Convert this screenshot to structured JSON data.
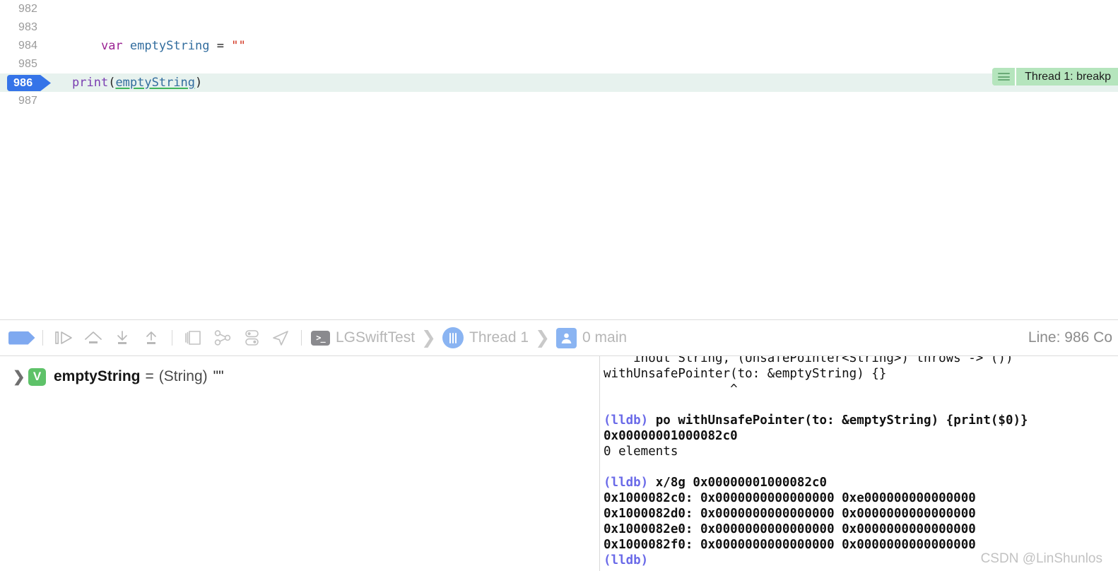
{
  "editor": {
    "lines": [
      {
        "number": "982",
        "segments": [],
        "current": false
      },
      {
        "number": "983",
        "segments": [],
        "current": false
      },
      {
        "number": "984",
        "current": false,
        "segments": [
          {
            "text": "    ",
            "cls": "tok-plain"
          },
          {
            "text": "var",
            "cls": "tok-kw"
          },
          {
            "text": " ",
            "cls": "tok-plain"
          },
          {
            "text": "emptyString",
            "cls": "tok-var"
          },
          {
            "text": " = ",
            "cls": "tok-plain"
          },
          {
            "text": "\"\"",
            "cls": "tok-str"
          }
        ]
      },
      {
        "number": "985",
        "segments": [],
        "current": false
      },
      {
        "number": "986",
        "current": true,
        "segments": [
          {
            "text": "print",
            "cls": "tok-fn"
          },
          {
            "text": "(",
            "cls": "tok-plain"
          },
          {
            "text": "emptyString",
            "cls": "tok-ident-u"
          },
          {
            "text": ")",
            "cls": "tok-plain"
          }
        ]
      },
      {
        "number": "987",
        "segments": [],
        "current": false
      }
    ],
    "breakpoint_line": "986",
    "annotation": {
      "text": "Thread 1: breakp",
      "background": "#b5e5bd"
    }
  },
  "debug_bar": {
    "buttons": [
      {
        "name": "breakpoints-toggle",
        "label": "Breakpoints"
      },
      {
        "name": "continue-button",
        "label": "Continue program execution"
      },
      {
        "name": "step-over-button",
        "label": "Step over"
      },
      {
        "name": "step-into-button",
        "label": "Step into"
      },
      {
        "name": "step-out-button",
        "label": "Step out"
      },
      {
        "name": "debug-view-hierarchy-button",
        "label": "Debug View Hierarchy"
      },
      {
        "name": "memory-graph-button",
        "label": "Debug Memory Graph"
      },
      {
        "name": "environment-overrides-button",
        "label": "Environment Overrides"
      },
      {
        "name": "simulate-location-button",
        "label": "Simulate Location"
      }
    ],
    "breadcrumb": [
      {
        "icon": "terminal-icon",
        "label": "LGSwiftTest"
      },
      {
        "icon": "thread-icon",
        "label": "Thread 1"
      },
      {
        "icon": "stack-frame-icon",
        "label": "0 main"
      }
    ],
    "chevron": "❯",
    "status": "Line: 986  Co"
  },
  "variables": {
    "chevron": "❯",
    "badge": "V",
    "name": "emptyString",
    "equals": "=",
    "type": "(String)",
    "value": "\"\""
  },
  "console": {
    "lines": [
      {
        "runs": [
          {
            "text": "    inout String, (UnsafePointer<String>) throws -> ())"
          }
        ]
      },
      {
        "runs": [
          {
            "text": "withUnsafePointer(to: &emptyString) {}"
          }
        ]
      },
      {
        "runs": [
          {
            "text": "                 ^"
          }
        ]
      },
      {
        "runs": [
          {
            "text": ""
          }
        ]
      },
      {
        "runs": [
          {
            "text": "(lldb)",
            "cls": "c-prompt"
          },
          {
            "text": " po withUnsafePointer(to: &emptyString) {print($0)}",
            "cls": "c-cmd"
          }
        ]
      },
      {
        "runs": [
          {
            "text": "0x00000001000082c0",
            "cls": "c-bold"
          }
        ]
      },
      {
        "runs": [
          {
            "text": "0 elements"
          }
        ]
      },
      {
        "runs": [
          {
            "text": ""
          }
        ]
      },
      {
        "runs": [
          {
            "text": "(lldb)",
            "cls": "c-prompt"
          },
          {
            "text": " x/8g 0x00000001000082c0",
            "cls": "c-cmd"
          }
        ]
      },
      {
        "runs": [
          {
            "text": "0x1000082c0: 0x0000000000000000 0xe000000000000000",
            "cls": "c-bold"
          }
        ]
      },
      {
        "runs": [
          {
            "text": "0x1000082d0: 0x0000000000000000 0x0000000000000000",
            "cls": "c-bold"
          }
        ]
      },
      {
        "runs": [
          {
            "text": "0x1000082e0: 0x0000000000000000 0x0000000000000000",
            "cls": "c-bold"
          }
        ]
      },
      {
        "runs": [
          {
            "text": "0x1000082f0: 0x0000000000000000 0x0000000000000000",
            "cls": "c-bold"
          }
        ]
      },
      {
        "runs": [
          {
            "text": "(lldb)",
            "cls": "c-prompt"
          }
        ]
      }
    ]
  },
  "watermark": "CSDN @LinShunlos"
}
